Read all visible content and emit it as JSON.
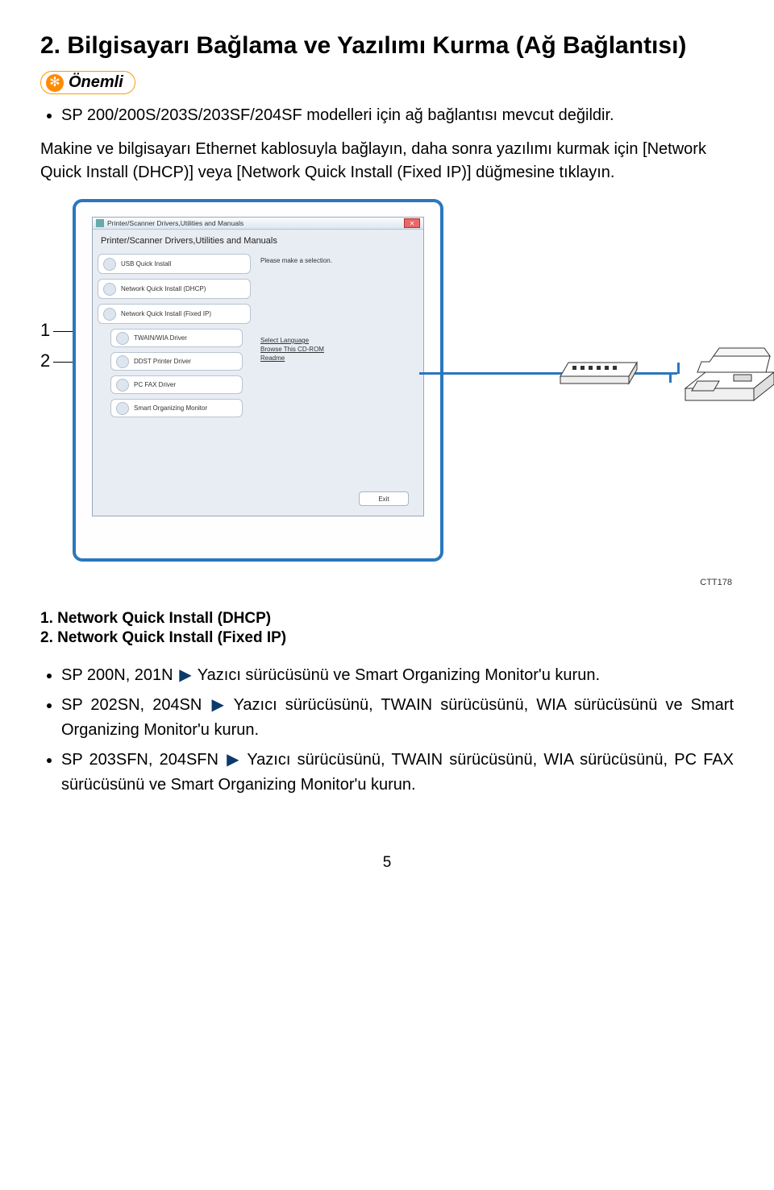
{
  "section": {
    "title": "2. Bilgisayarı Bağlama ve Yazılımı Kurma (Ağ Bağlantısı)"
  },
  "important": {
    "label": "Önemli",
    "star": "✻"
  },
  "intro_bullet": "SP 200/200S/203S/203SF/204SF modelleri için ağ bağlantısı mevcut değildir.",
  "paragraph": "Makine ve bilgisayarı Ethernet kablosuyla bağlayın, daha sonra yazılımı kurmak için [Network Quick Install (DHCP)] veya [Network Quick Install (Fixed IP)] düğmesine tıklayın.",
  "callout_numbers": [
    "1",
    "2"
  ],
  "dialog": {
    "title": "Printer/Scanner Drivers,Utilities and Manuals",
    "header": "Printer/Scanner Drivers,Utilities and Manuals",
    "buttons": {
      "usb": "USB Quick Install",
      "dhcp": "Network Quick Install (DHCP)",
      "fixed": "Network Quick Install (Fixed IP)",
      "twain": "TWAIN/WIA Driver",
      "ddst": "DDST Printer Driver",
      "pcfax": "PC FAX Driver",
      "smart": "Smart Organizing Monitor"
    },
    "right_note": "Please make a selection.",
    "links": {
      "lang": "Select Language",
      "browse": "Browse This CD-ROM",
      "readme": "Readme"
    },
    "exit": "Exit"
  },
  "figcode": "CTT178",
  "legend": {
    "l1": "1. Network Quick Install (DHCP)",
    "l2": "2. Network Quick Install (Fixed IP)"
  },
  "items": [
    {
      "models": "SP 200N, 201N",
      "arrow": "▶",
      "text": "Yazıcı sürücüsünü ve Smart Organizing Monitor'u kurun."
    },
    {
      "models": "SP 202SN, 204SN",
      "arrow": "▶",
      "text": "Yazıcı sürücüsünü, TWAIN sürücüsünü, WIA sürücüsünü ve Smart Organizing Monitor'u kurun."
    },
    {
      "models": "SP 203SFN, 204SFN",
      "arrow": "▶",
      "text": "Yazıcı sürücüsünü, TWAIN sürücüsünü, WIA sürücüsünü, PC FAX sürücüsünü ve Smart Organizing Monitor'u kurun."
    }
  ],
  "page_number": "5"
}
